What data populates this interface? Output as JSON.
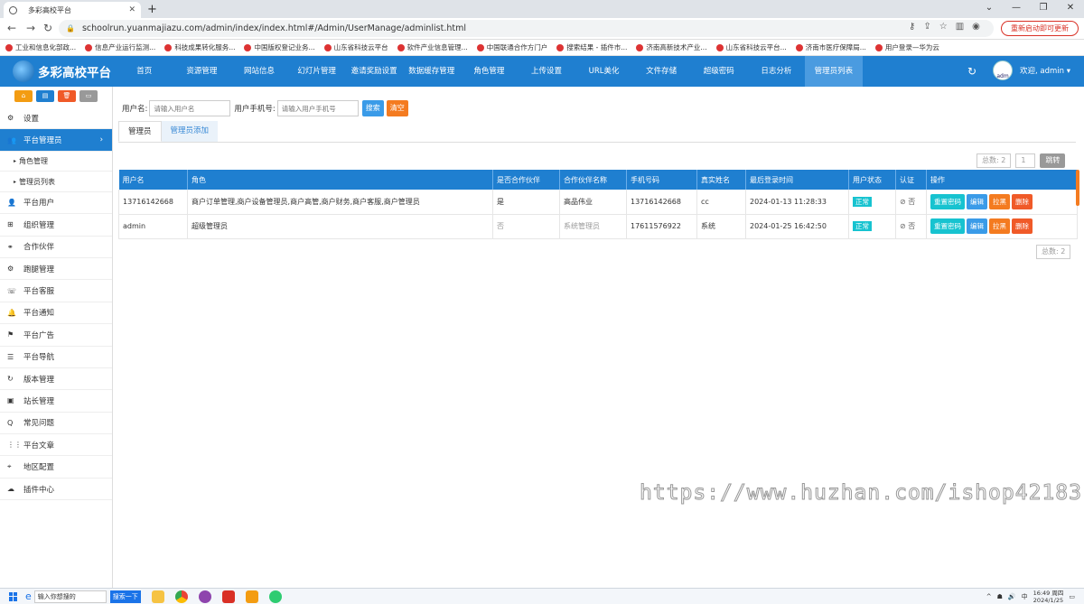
{
  "browser": {
    "tab_title": "多彩高校平台",
    "url": "schoolrun.yuanmajiazu.com/admin/index/index.html#/Admin/UserManage/adminlist.html",
    "update_label": "重新启动即可更新",
    "bookmarks": [
      "工业和信息化部政...",
      "信息产业运行监测...",
      "科技成果转化服务...",
      "中国版权登记业务...",
      "山东省科技云平台",
      "软件产业信息管理...",
      "中国联通合作方门户",
      "搜索结果 - 插件市...",
      "济南高新技术产业...",
      "山东省科技云平台...",
      "济南市医疗保障局...",
      "用户登录—华为云"
    ]
  },
  "header": {
    "logo": "多彩高校平台",
    "menu": [
      "首页",
      "资源管理",
      "网站信息",
      "幻灯片管理",
      "邀请奖励设置",
      "数据缓存管理",
      "角色管理",
      "上传设置",
      "URL美化",
      "文件存储",
      "超级密码",
      "日志分析",
      "管理员列表"
    ],
    "user_label": "欢迎, admin ▾",
    "avatar_text": "adm"
  },
  "sidebar": {
    "items": [
      {
        "label": "设置",
        "icon": "gear-icon",
        "glyph": "⚙"
      },
      {
        "label": "平台管理员",
        "icon": "users-icon",
        "glyph": "👥",
        "active": true
      },
      {
        "label": "平台用户",
        "icon": "user-icon",
        "glyph": "👤"
      },
      {
        "label": "组织管理",
        "icon": "org-icon",
        "glyph": "⊞"
      },
      {
        "label": "合作伙伴",
        "icon": "handshake-icon",
        "glyph": "⚭"
      },
      {
        "label": "跑腿管理",
        "icon": "motorcycle-icon",
        "glyph": "⚙"
      },
      {
        "label": "平台客服",
        "icon": "phone-icon",
        "glyph": "☏"
      },
      {
        "label": "平台通知",
        "icon": "bell-icon",
        "glyph": "🔔"
      },
      {
        "label": "平台广告",
        "icon": "flag-icon",
        "glyph": "⚑"
      },
      {
        "label": "平台导航",
        "icon": "list-icon",
        "glyph": "☰"
      },
      {
        "label": "版本管理",
        "icon": "refresh-icon",
        "glyph": "↻"
      },
      {
        "label": "站长管理",
        "icon": "id-card-icon",
        "glyph": "▣"
      },
      {
        "label": "常见问题",
        "icon": "question-icon",
        "glyph": "Q"
      },
      {
        "label": "平台文章",
        "icon": "grid-icon",
        "glyph": "⋮⋮"
      },
      {
        "label": "地区配置",
        "icon": "map-pin-icon",
        "glyph": "⌖"
      },
      {
        "label": "插件中心",
        "icon": "cloud-icon",
        "glyph": "☁"
      }
    ],
    "subitems": [
      "角色管理",
      "管理员列表"
    ]
  },
  "search": {
    "username_label": "用户名:",
    "username_placeholder": "请输入用户名",
    "phone_label": "用户手机号:",
    "phone_placeholder": "请输入用户手机号",
    "search_btn": "搜索",
    "clear_btn": "清空"
  },
  "tabs": [
    "管理员",
    "管理员添加"
  ],
  "pager": {
    "total": "总数: 2",
    "page": "1",
    "go": "跳转"
  },
  "table": {
    "headers": [
      "用户名",
      "角色",
      "是否合作伙伴",
      "合作伙伴名称",
      "手机号码",
      "真实姓名",
      "最后登录时间",
      "用户状态",
      "认证",
      "操作"
    ],
    "rows": [
      {
        "username": "13716142668",
        "role": "商户订单管理,商户设备管理员,商户高管,商户财务,商户客服,商户管理员",
        "partner": "是",
        "partner_name": "高品伟业",
        "phone": "13716142668",
        "realname": "cc",
        "last_login": "2024-01-13 11:28:33",
        "status": "正常",
        "auth": "⊘ 否"
      },
      {
        "username": "admin",
        "role": "超级管理员",
        "partner": "否",
        "partner_name": "系统管理员",
        "phone": "17611576922",
        "realname": "系统",
        "last_login": "2024-01-25 16:42:50",
        "status": "正常",
        "auth": "⊘ 否"
      }
    ],
    "actions": [
      "重置密码",
      "编辑",
      "拉黑",
      "删除"
    ]
  },
  "footer_total": "总数: 2",
  "watermark": "https://www.huzhan.com/ishop42183",
  "taskbar": {
    "search_placeholder": "输入你想搜的",
    "search_btn": "搜索一下",
    "time": "16:49 周四",
    "date": "2024/1/25"
  }
}
